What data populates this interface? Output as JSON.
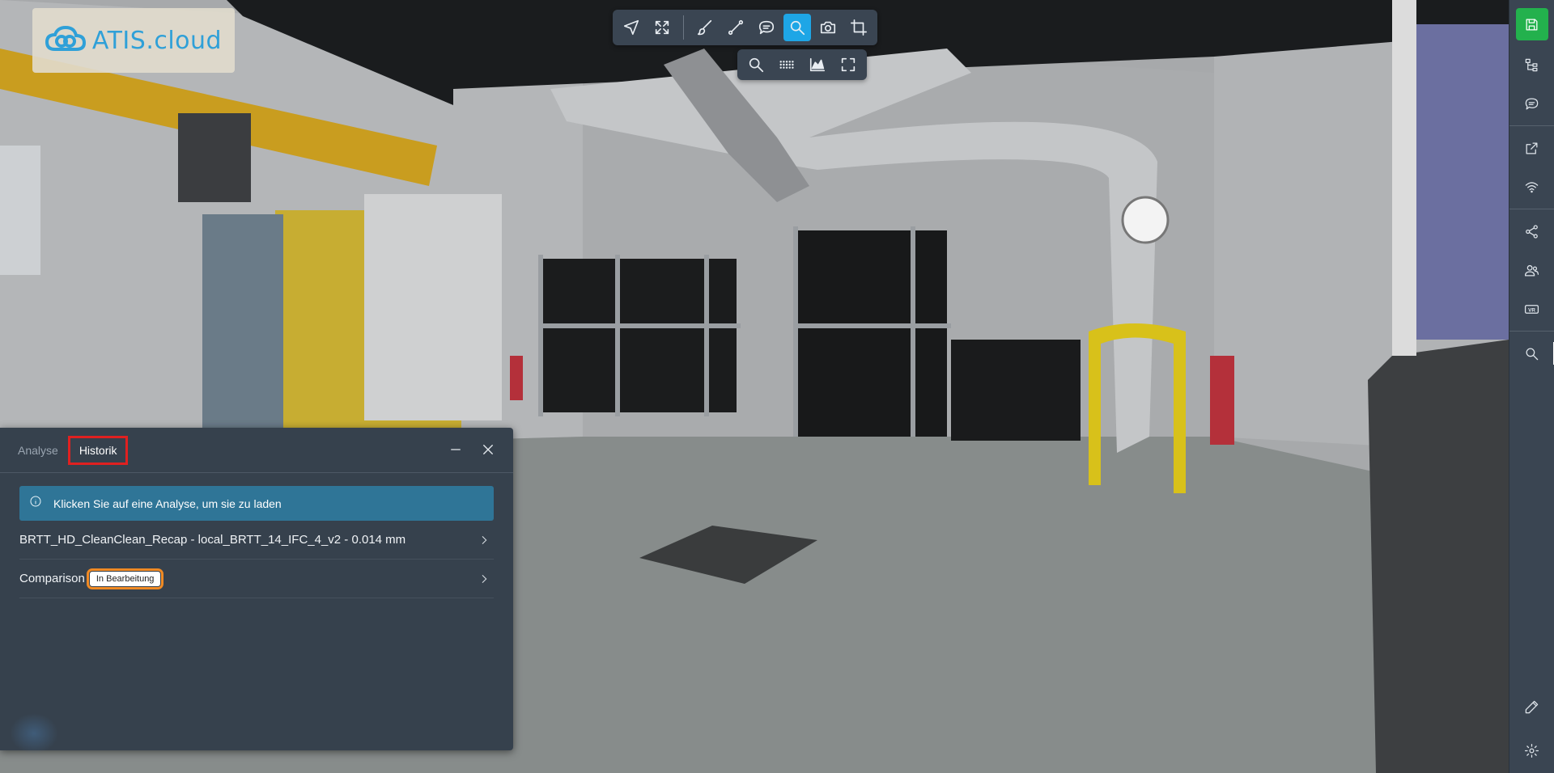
{
  "logo": {
    "text": "ATIS.cloud"
  },
  "toolbar": {
    "main": [
      {
        "icon": "navigate-icon"
      },
      {
        "icon": "fit-view-icon"
      },
      {
        "icon": "brush-icon"
      },
      {
        "icon": "measure-line-icon"
      },
      {
        "icon": "comment-icon"
      },
      {
        "icon": "search-icon",
        "active": true
      },
      {
        "icon": "camera-icon"
      },
      {
        "icon": "crop-icon"
      }
    ],
    "sub": [
      {
        "icon": "zoom-icon"
      },
      {
        "icon": "point-grid-icon"
      },
      {
        "icon": "chart-area-icon"
      },
      {
        "icon": "fullscreen-icon"
      }
    ]
  },
  "sidebar": {
    "items": [
      {
        "icon": "save-icon"
      },
      {
        "icon": "tree-icon"
      },
      {
        "icon": "chat-icon"
      },
      {
        "icon": "external-link-icon"
      },
      {
        "icon": "wifi-icon"
      },
      {
        "icon": "share-icon"
      },
      {
        "icon": "users-icon"
      },
      {
        "icon": "vr-icon",
        "label": "VR"
      },
      {
        "icon": "search-icon"
      },
      {
        "icon": "pencil-icon"
      },
      {
        "icon": "settings-icon"
      }
    ]
  },
  "panel": {
    "tabs": [
      {
        "label": "Analyse",
        "active": false
      },
      {
        "label": "Historik",
        "active": true
      }
    ],
    "info_text": "Klicken Sie auf eine Analyse, um sie zu laden",
    "rows": [
      {
        "title": "BRTT_HD_CleanClean_Recap - local_BRTT_14_IFC_4_v2 - 0.014 mm"
      },
      {
        "title": "Comparison",
        "badge": "In Bearbeitung"
      }
    ]
  },
  "colors": {
    "accent": "#1ea6e6",
    "save_green": "#23b14d",
    "tab_highlight": "#e02020",
    "badge_highlight": "#f08a24",
    "panel_bg": "#36414d",
    "info_bg": "#2f7597"
  }
}
